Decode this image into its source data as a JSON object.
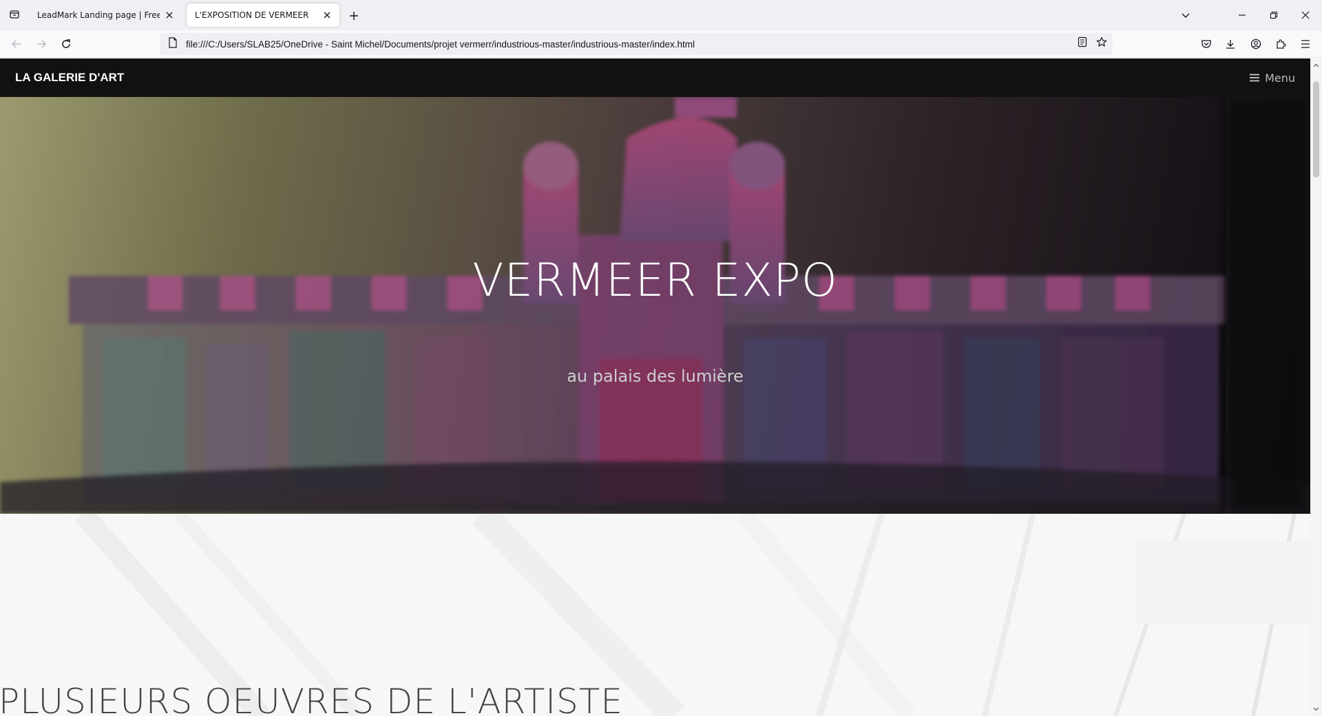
{
  "browser": {
    "tabs": [
      {
        "title": "LeadMark Landing page | Free Boot",
        "active": false
      },
      {
        "title": "L'EXPOSITION DE VERMEER",
        "active": true
      }
    ],
    "url": "file:///C:/Users/SLAB25/OneDrive - Saint Michel/Documents/projet vermerr/industrious-master/industrious-master/index.html"
  },
  "site": {
    "logo": "LA GALERIE D'ART",
    "menu_label": "Menu"
  },
  "hero": {
    "title": "VERMEER EXPO",
    "subtitle": "au palais des lumière"
  },
  "section": {
    "title": "PLUSIEURS OEUVRES DE L'ARTISTE"
  },
  "colors": {
    "header_bg": "#111111",
    "accent_text": "#ffffff"
  }
}
